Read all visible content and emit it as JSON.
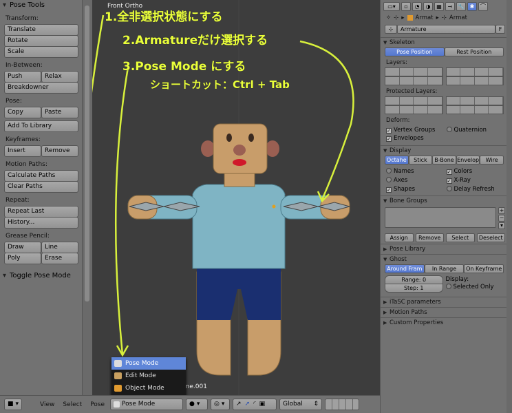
{
  "toolshelf": {
    "title": "Pose Tools",
    "sections": {
      "transform": "Transform:",
      "translate": "Translate",
      "rotate": "Rotate",
      "scale": "Scale",
      "inbetween": "In-Between:",
      "push": "Push",
      "relax": "Relax",
      "breakdowner": "Breakdowner",
      "pose": "Pose:",
      "copy": "Copy",
      "paste": "Paste",
      "add_to_library": "Add To Library",
      "keyframes": "Keyframes:",
      "insert": "Insert",
      "remove": "Remove",
      "motion_paths": "Motion Paths:",
      "calculate_paths": "Calculate Paths",
      "clear_paths": "Clear Paths",
      "repeat": "Repeat:",
      "repeat_last": "Repeat Last",
      "history": "History...",
      "grease_pencil": "Grease Pencil:",
      "draw": "Draw",
      "line": "Line",
      "poly": "Poly",
      "erase": "Erase",
      "toggle_pose_mode": "Toggle Pose Mode"
    }
  },
  "viewport": {
    "title": "Front Ortho",
    "object_label": "Bone.001"
  },
  "annotations": {
    "step1": "1.全非選択状態にする",
    "step2": "2.Armatureだけ選択する",
    "step3": "3.Pose Mode にする",
    "shortcut": "ショートカット：Ctrl + Tab"
  },
  "mode_menu": {
    "items": [
      "Pose Mode",
      "Edit Mode",
      "Object Mode"
    ],
    "selected": "Pose Mode"
  },
  "bottom_header": {
    "view": "View",
    "select": "Select",
    "pose": "Pose",
    "mode_value": "Pose Mode",
    "orientation": "Global"
  },
  "properties": {
    "breadcrumb_armat1": "Armat",
    "breadcrumb_armat2": "Armat",
    "datablock_name": "Armature",
    "datablock_flag": "F",
    "skeleton": {
      "title": "Skeleton",
      "pose_position": "Pose Position",
      "rest_position": "Rest Position",
      "layers": "Layers:",
      "protected_layers": "Protected Layers:",
      "deform": "Deform:",
      "vertex_groups": "Vertex Groups",
      "quaternion": "Quaternion",
      "envelopes": "Envelopes"
    },
    "display": {
      "title": "Display",
      "tabs": [
        "Octahe",
        "Stick",
        "B-Bone",
        "Envelop",
        "Wire"
      ],
      "names": "Names",
      "colors": "Colors",
      "axes": "Axes",
      "xray": "X-Ray",
      "shapes": "Shapes",
      "delay_refresh": "Delay Refresh"
    },
    "bone_groups": {
      "title": "Bone Groups",
      "assign": "Assign",
      "remove": "Remove",
      "select": "Select",
      "deselect": "Deselect"
    },
    "pose_library": "Pose Library",
    "ghost": {
      "title": "Ghost",
      "tabs": [
        "Around Fram",
        "In Range",
        "On Keyframe"
      ],
      "range": "Range: 0",
      "step": "Step: 1",
      "display": "Display:",
      "selected_only": "Selected Only"
    },
    "itasc": "iTaSC parameters",
    "motion_paths": "Motion Paths",
    "custom_properties": "Custom Properties"
  }
}
